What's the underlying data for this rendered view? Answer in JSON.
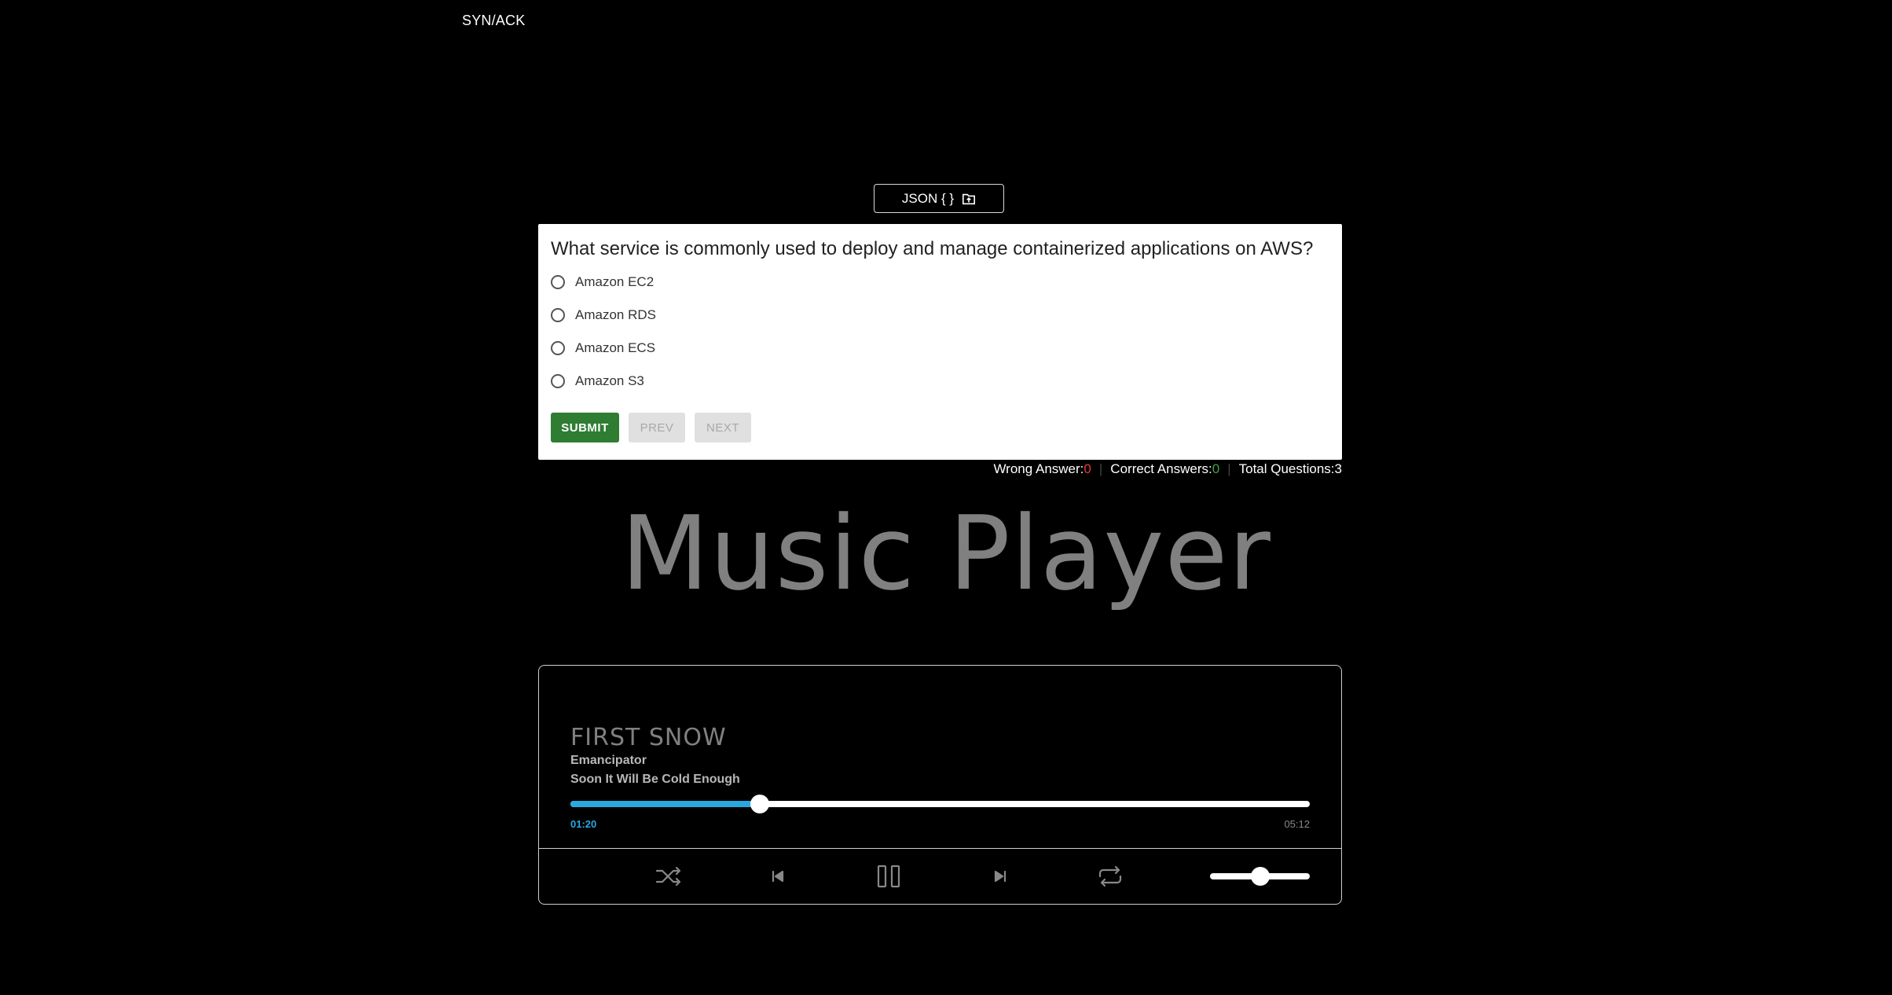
{
  "header": {
    "brand": "SYN/ACK"
  },
  "json_button": {
    "label": "JSON { }",
    "icon": "folder-upload-icon"
  },
  "quiz": {
    "question": "What service is commonly used to deploy and manage containerized applications on AWS?",
    "options": [
      "Amazon EC2",
      "Amazon RDS",
      "Amazon ECS",
      "Amazon S3"
    ],
    "buttons": {
      "submit": "SUBMIT",
      "prev": "PREV",
      "next": "NEXT"
    },
    "stats": {
      "wrong_label": "Wrong Answer: ",
      "wrong_value": "0",
      "correct_label": "Correct Answers: ",
      "correct_value": "0",
      "total_label": "Total Questions: ",
      "total_value": "3"
    },
    "colors": {
      "submit": "#2e7d32",
      "wrong": "#e53935",
      "correct": "#43a047"
    }
  },
  "music_player": {
    "heading": "Music Player",
    "song_title": "FIRST SNOW",
    "artist": "Emancipator",
    "album": "Soon It Will Be Cold Enough",
    "current_time": "01:20",
    "duration": "05:12",
    "progress": 0.2564,
    "volume": 0.5,
    "accent_color": "#29a8e0",
    "controls": [
      "shuffle-icon",
      "previous-icon",
      "pause-icon",
      "next-icon",
      "repeat-icon"
    ]
  }
}
